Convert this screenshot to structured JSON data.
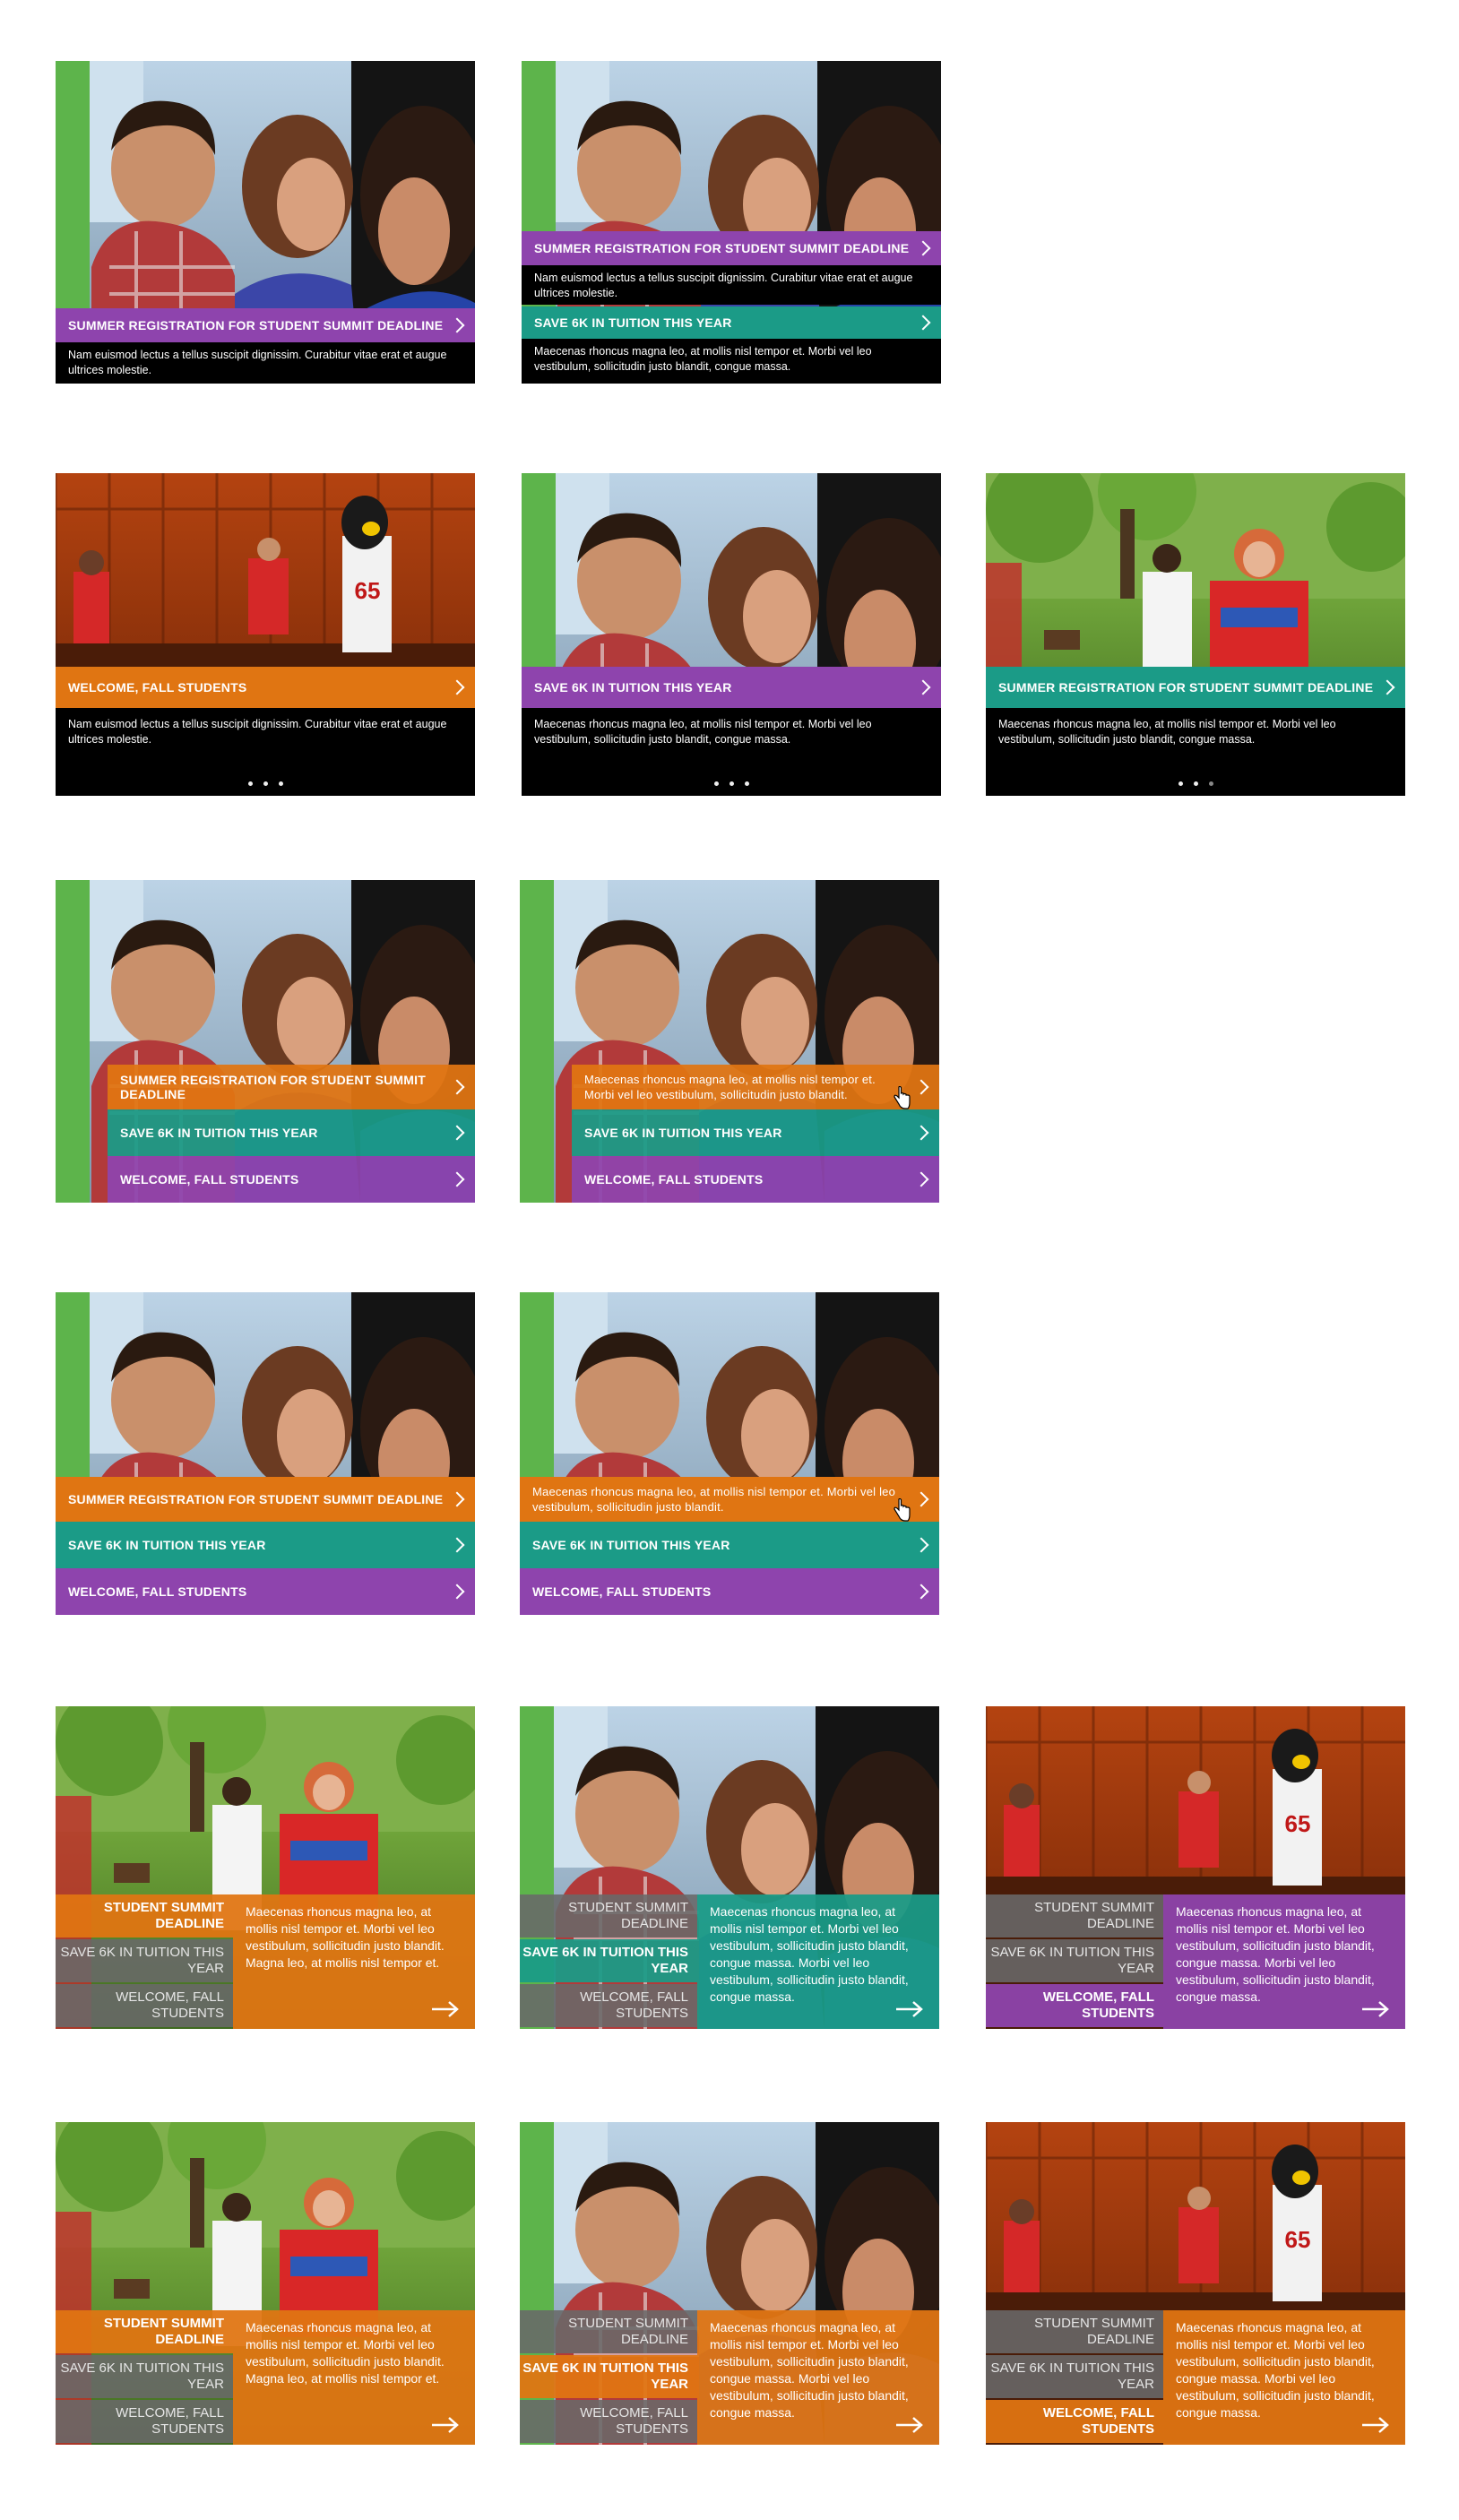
{
  "texts": {
    "summer": "SUMMER REGISTRATION FOR STUDENT SUMMIT DEADLINE",
    "summer_short": "STUDENT SUMMIT DEADLINE",
    "save": "SAVE 6K IN TUITION THIS YEAR",
    "welcome": "WELCOME, FALL STUDENTS",
    "nam_desc": "Nam euismod lectus a tellus suscipit dignissim. Curabitur vitae erat et augue ultrices molestie.",
    "mae_desc": "Maecenas rhoncus magna leo, at mollis nisl tempor et. Morbi vel leo vestibulum, sollicitudin justo blandit, congue massa.",
    "mae_short": "Maecenas rhoncus magna leo, at mollis nisl tempor et. Morbi vel leo vestibulum, sollicitudin justo blandit.",
    "mae_panel_a": "Maecenas rhoncus magna leo, at mollis nisl tempor et. Morbi vel leo vestibulum, sollicitudin justo blandit. Magna leo, at mollis nisl tempor et.",
    "mae_panel_b": "Maecenas rhoncus magna leo, at mollis nisl tempor et. Morbi vel leo vestibulum, sollicitudin justo blandit, congue massa. Morbi vel leo vestibulum, sollicitudin justo blandit, congue massa."
  },
  "colors": {
    "purple": "#8e44ad",
    "teal": "#1b9b87",
    "orange": "#e07512",
    "gray": "#696969"
  },
  "icons": [
    "chevron-right-icon",
    "arrow-right-icon",
    "hand-cursor-icon",
    "carousel-dot-icon"
  ]
}
